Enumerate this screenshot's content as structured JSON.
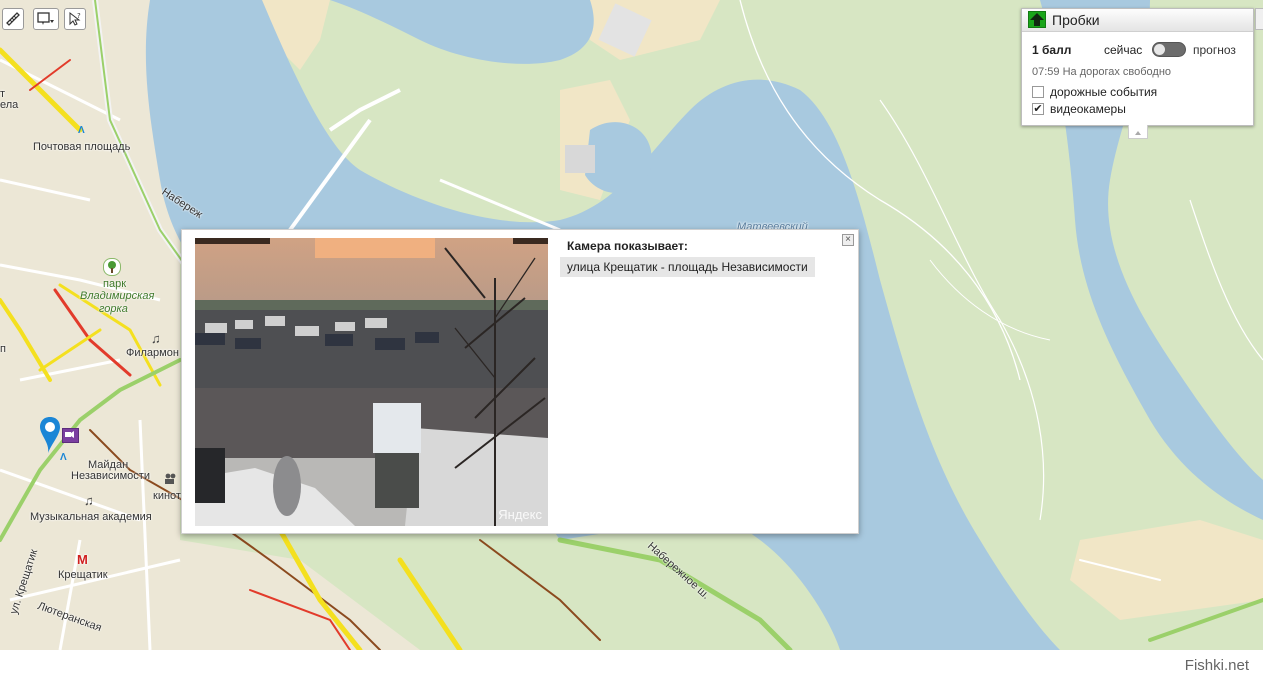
{
  "map": {
    "labels": {
      "pochtovaya": "Почтовая площадь",
      "naberezh_top": "Набереж",
      "park_line1": "парк",
      "park_line2": "Владимирская",
      "park_line3": "горка",
      "filarmon": "Филармон",
      "maidan_line1": "Майдан",
      "maidan_line2": "Независимости",
      "kino": "кинотеа",
      "music_academy": "Музыкальная академия",
      "khreshchatyk": "Крещатик",
      "metro_letter": "М",
      "matveevsky": "Матвеевский",
      "naberezh_shosse": "Набережное ш.",
      "khresh_street": "ул. Крещатик",
      "lyuteran": "Лютеранская",
      "edge_t": "т",
      "edge_ela": "ела",
      "edge_p": "п"
    },
    "icons": [
      "ruler-icon",
      "add-point-icon",
      "cursor-help-icon",
      "park-tree-icon",
      "music-note-icon",
      "cinema-icon",
      "metro-icon",
      "webcam-marker-icon",
      "map-pin-icon"
    ]
  },
  "traffic": {
    "title": "Пробки",
    "score": "1 балл",
    "now_label": "сейчас",
    "forecast_label": "прогноз",
    "status": "07:59 На дорогах свободно",
    "options": [
      {
        "label": "дорожные события",
        "checked": false
      },
      {
        "label": "видеокамеры",
        "checked": true
      }
    ],
    "check_mark": "✔",
    "accent": "#1aa51a"
  },
  "camera_popup": {
    "title": "Камера показывает:",
    "location": "улица Крещатик - площадь Независимости",
    "watermark": "Яндекс",
    "close_symbol": "×"
  },
  "footer": {
    "brand": "Fishki.net"
  }
}
